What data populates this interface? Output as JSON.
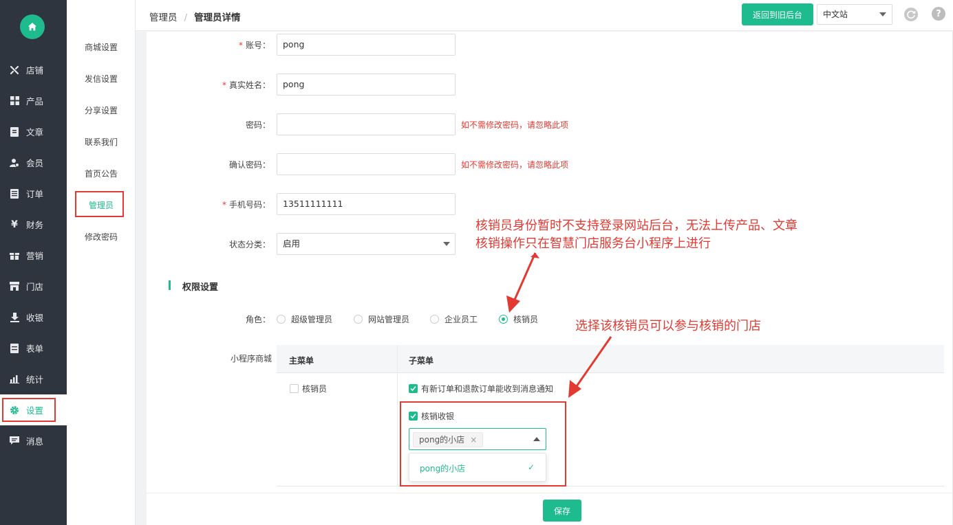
{
  "sidebar": {
    "items": [
      {
        "label": "店铺",
        "icon": "tools-icon"
      },
      {
        "label": "产品",
        "icon": "grid-icon"
      },
      {
        "label": "文章",
        "icon": "document-icon"
      },
      {
        "label": "会员",
        "icon": "user-icon"
      },
      {
        "label": "订单",
        "icon": "list-icon"
      },
      {
        "label": "财务",
        "icon": "yen-icon"
      },
      {
        "label": "营销",
        "icon": "gift-icon"
      },
      {
        "label": "门店",
        "icon": "store-icon"
      },
      {
        "label": "收银",
        "icon": "download-icon"
      },
      {
        "label": "表单",
        "icon": "form-icon"
      },
      {
        "label": "统计",
        "icon": "chart-icon"
      },
      {
        "label": "设置",
        "icon": "gear-icon"
      },
      {
        "label": "消息",
        "icon": "message-icon"
      }
    ],
    "active": "设置"
  },
  "submenu": {
    "items": [
      "商城设置",
      "发信设置",
      "分享设置",
      "联系我们",
      "首页公告",
      "管理员",
      "修改密码"
    ],
    "active": "管理员"
  },
  "header": {
    "breadcrumb_parent": "管理员",
    "breadcrumb_separator": "/",
    "breadcrumb_current": "管理员详情",
    "back_button": "返回到旧后台",
    "language": "中文站"
  },
  "form": {
    "account": {
      "label": "账号：",
      "value": "pong"
    },
    "real_name": {
      "label": "真实姓名：",
      "value": "pong"
    },
    "password": {
      "label": "密码：",
      "value": "",
      "hint": "如不需修改密码，请忽略此项"
    },
    "confirm_password": {
      "label": "确认密码：",
      "value": "",
      "hint": "如不需修改密码，请忽略此项"
    },
    "phone": {
      "label": "手机号码：",
      "value": "13511111111"
    },
    "status": {
      "label": "状态分类：",
      "value": "启用"
    },
    "required_mark": "*"
  },
  "permissions": {
    "section_title": "权限设置",
    "role_label": "角色：",
    "roles": [
      "超级管理员",
      "网站管理员",
      "企业员工",
      "核销员"
    ],
    "selected_role": "核销员",
    "miniapp_label": "小程序商城",
    "table": {
      "col_main": "主菜单",
      "col_sub": "子菜单",
      "main_item": {
        "label": "核销员",
        "checked": false
      },
      "sub_items": [
        {
          "label": "有新订单和退款订单能收到消息通知",
          "checked": true
        },
        {
          "label": "核销收银",
          "checked": true
        }
      ]
    },
    "store_select": {
      "selected_tag": "pong的小店",
      "tag_close": "×",
      "options": [
        "pong的小店"
      ],
      "option_check": "✓"
    }
  },
  "annotations": {
    "note1_line1": "核销员身份暂时不支持登录网站后台，无法上传产品、文章",
    "note1_line2": "核销操作只在智慧门店服务台小程序上进行",
    "note2": "选择该核销员可以参与核销的门店"
  },
  "footer": {
    "save_button": "保存"
  },
  "colors": {
    "accent": "#1dbb8d",
    "annotation": "#e23a32",
    "sidebar_bg": "#2f353f"
  }
}
